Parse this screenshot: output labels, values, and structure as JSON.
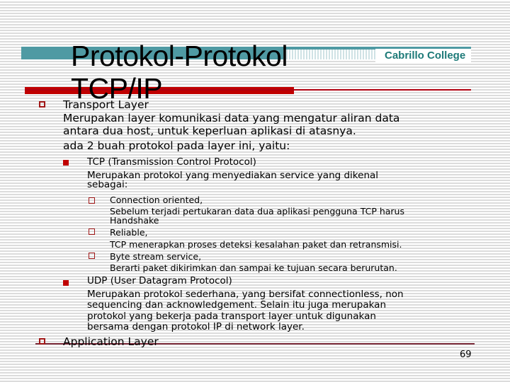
{
  "header": {
    "title_line1": "Protokol-Protokol",
    "title_line2": "TCP/IP",
    "college": "Cabrillo College"
  },
  "colors": {
    "teal": "#4f9aa3",
    "red": "#c00000",
    "college_text": "#1d7a78"
  },
  "content": {
    "transport": {
      "heading": "Transport Layer",
      "lines": [
        "Merupakan layer komunikasi data yang mengatur aliran data",
        "antara dua host, untuk keperluan aplikasi di atasnya.",
        "ada 2 buah protokol pada layer ini, yaitu:"
      ],
      "tcp": {
        "heading": "TCP (Transmission Control Protocol)",
        "lines": [
          "Merupakan protokol yang menyediakan service yang dikenal",
          "sebagai:"
        ],
        "services": [
          {
            "label": "Connection oriented,",
            "lines": [
              "Sebelum terjadi pertukaran data dua aplikasi pengguna TCP harus",
              "Handshake"
            ]
          },
          {
            "label": "Reliable,",
            "lines": [
              "TCP menerapkan proses deteksi kesalahan paket dan retransmisi."
            ]
          },
          {
            "label": "Byte stream service,",
            "lines": [
              "Berarti paket dikirimkan dan sampai ke tujuan secara berurutan."
            ]
          }
        ]
      },
      "udp": {
        "heading": "UDP (User Datagram Protocol)",
        "lines": [
          "Merupakan protokol sederhana, yang bersifat connectionless, non",
          "sequencing dan acknowledgement. Selain itu juga merupakan",
          "protokol yang bekerja pada transport layer untuk digunakan",
          "bersama dengan protokol IP di network layer."
        ]
      }
    },
    "application": {
      "heading": "Application Layer"
    }
  },
  "footer": {
    "page_number": "69"
  }
}
